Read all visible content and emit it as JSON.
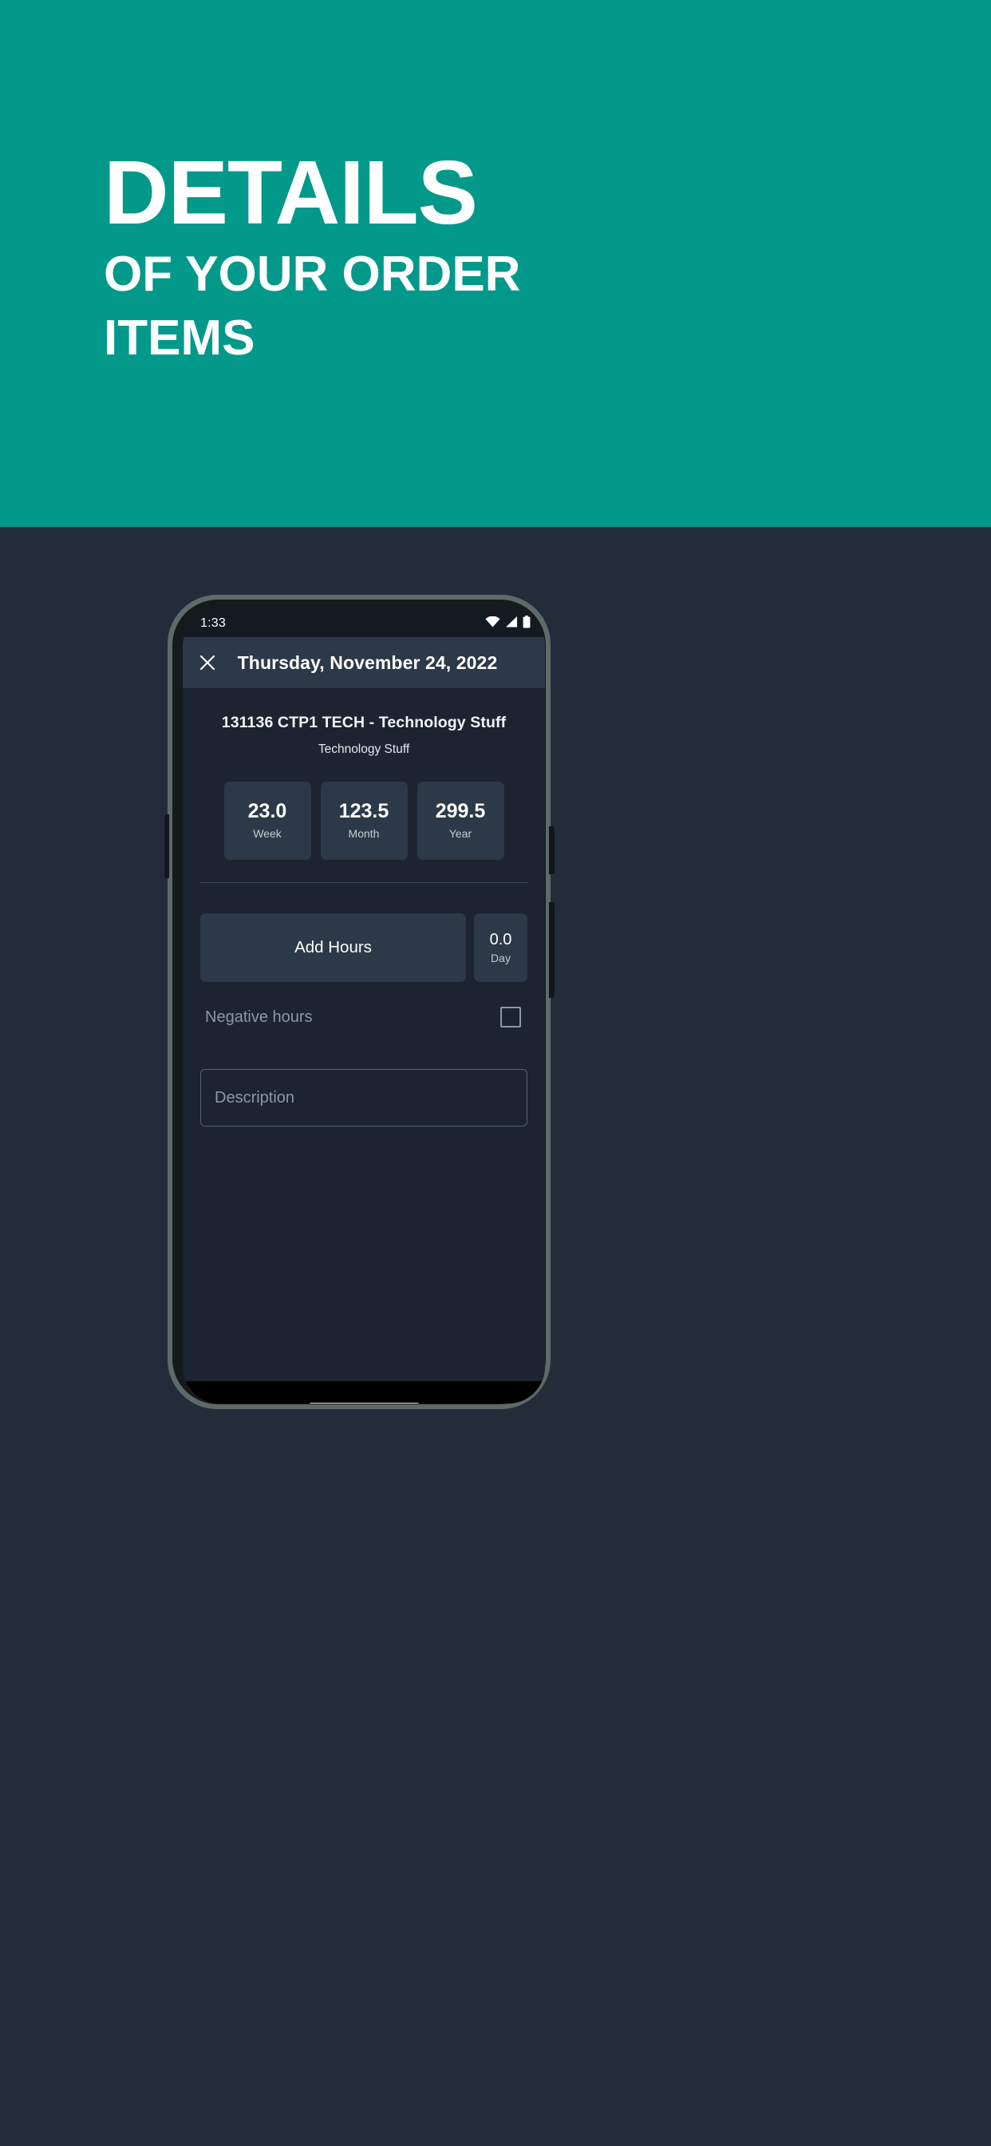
{
  "banner": {
    "headline_line1": "DETAILS",
    "headline_line2": "OF YOUR ORDER",
    "headline_line3": "ITEMS",
    "background_color": "#03998a",
    "text_color": "#ffffff"
  },
  "page": {
    "background_color": "#232d3a"
  },
  "phone": {
    "statusbar": {
      "time": "1:33",
      "icons": [
        "wifi-icon",
        "cell-signal-icon",
        "battery-icon"
      ]
    },
    "appbar": {
      "close_icon": "close-icon",
      "title": "Thursday, November 24, 2022",
      "background_color": "#2b3948"
    },
    "content": {
      "background_color": "#1b2430",
      "item_title": "131136 CTP1 TECH - Technology Stuff",
      "item_subtitle": "Technology Stuff",
      "stats": [
        {
          "value": "23.0",
          "label": "Week"
        },
        {
          "value": "123.5",
          "label": "Month"
        },
        {
          "value": "299.5",
          "label": "Year"
        }
      ],
      "add_hours_label": "Add Hours",
      "day": {
        "value": "0.0",
        "label": "Day"
      },
      "negative_hours": {
        "label": "Negative hours",
        "checked": false
      },
      "description": {
        "value": "",
        "placeholder": "Description"
      }
    },
    "navbar": {
      "gesture_pill": "home-gesture-pill"
    }
  }
}
